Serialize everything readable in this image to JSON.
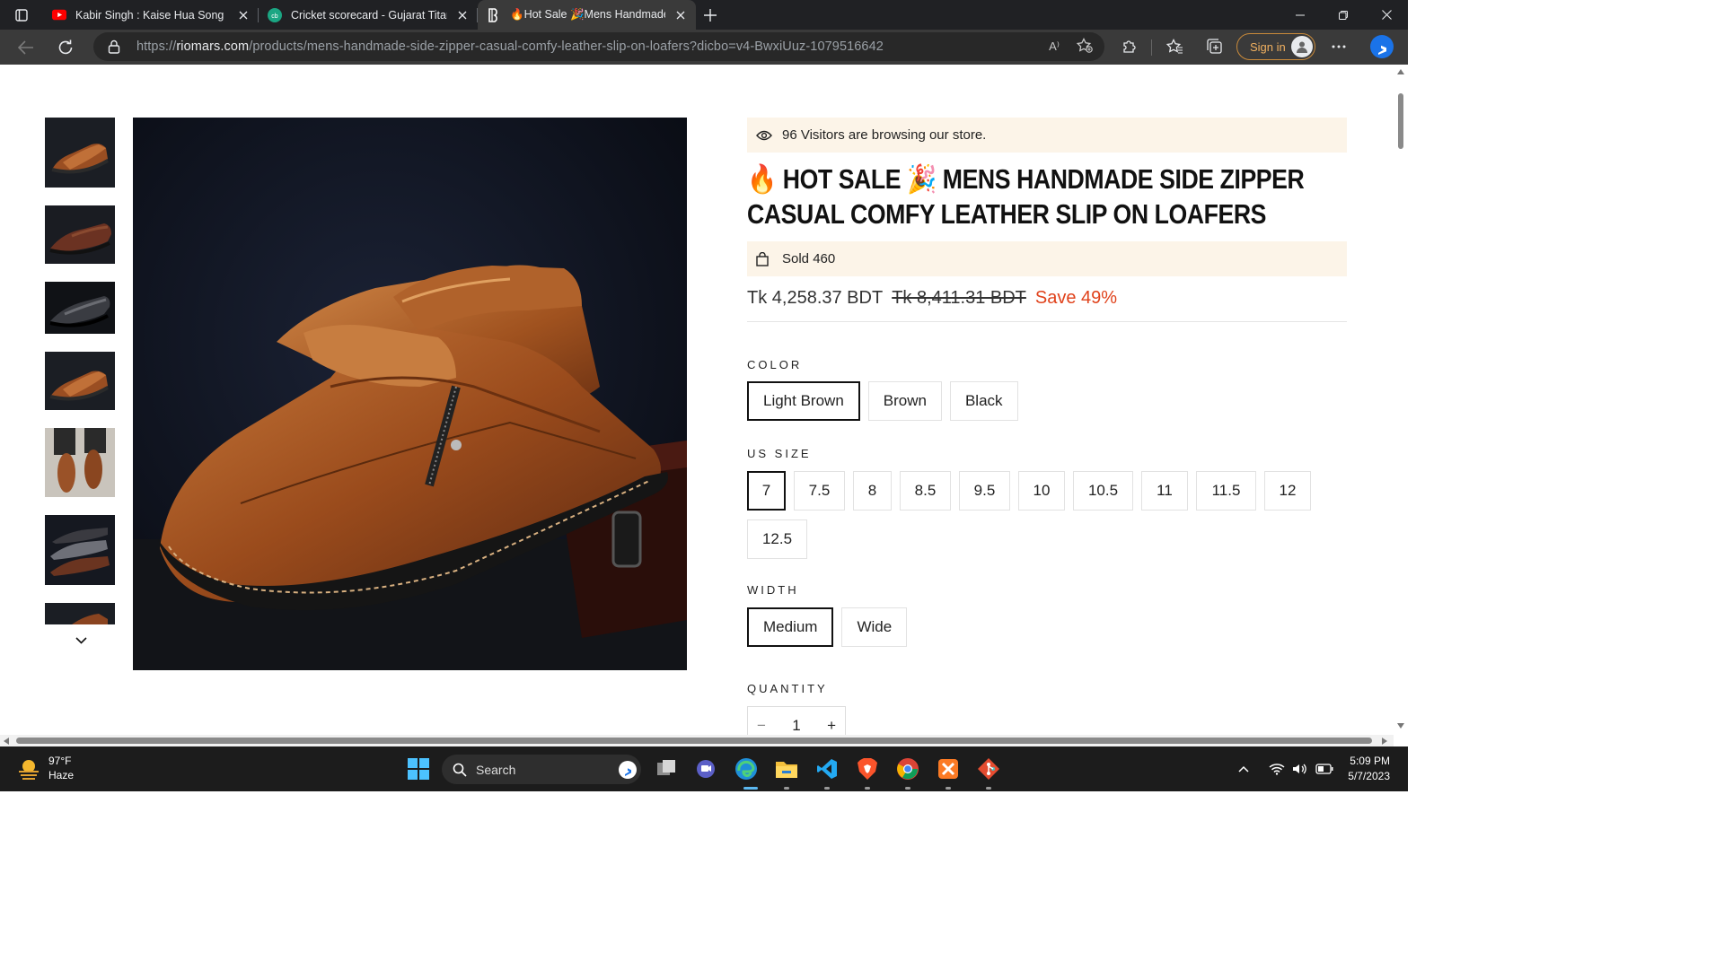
{
  "browser": {
    "tabs": [
      {
        "title": "Kabir Singh : Kaise Hua Song | Sh",
        "icon": "youtube-icon",
        "active": false
      },
      {
        "title": "Cricket scorecard - Gujarat Titans",
        "icon": "cricbuzz-icon",
        "active": false
      },
      {
        "title": "🔥Hot Sale 🎉Mens Handmade",
        "icon": "site-logo-icon",
        "active": true
      }
    ],
    "url_prefix": "https://",
    "url_domain": "riomars.com",
    "url_path": "/products/mens-handmade-side-zipper-casual-comfy-leather-slip-on-loafers?dicbo=v4-BwxiUuz-1079516642",
    "read_aloud": "A⁾",
    "signin_label": "Sign in",
    "accent_color": "#f0b060"
  },
  "product": {
    "visitors_text": "96 Visitors are browsing our store.",
    "title": "🔥 HOT SALE 🎉 MENS HANDMADE SIDE ZIPPER CASUAL COMFY LEATHER SLIP ON LOAFERS",
    "sold_text": "Sold 460",
    "price_now": "Tk 4,258.37 BDT",
    "price_was": "Tk 8,411.31 BDT",
    "save_text": "Save 49%",
    "save_color": "#e0421b",
    "color_label": "COLOR",
    "colors": [
      "Light Brown",
      "Brown",
      "Black"
    ],
    "color_selected": "Light Brown",
    "size_label": "US SIZE",
    "sizes": [
      "7",
      "7.5",
      "8",
      "8.5",
      "9.5",
      "10",
      "10.5",
      "11",
      "11.5",
      "12",
      "12.5"
    ],
    "size_selected": "7",
    "width_label": "WIDTH",
    "widths": [
      "Medium",
      "Wide"
    ],
    "width_selected": "Medium",
    "quantity_label": "QUANTITY",
    "quantity_minus": "−",
    "quantity_value": "1",
    "quantity_plus": "+"
  },
  "taskbar": {
    "temperature": "97°F",
    "weather": "Haze",
    "search_label": "Search",
    "time": "5:09 PM",
    "date": "5/7/2023"
  }
}
